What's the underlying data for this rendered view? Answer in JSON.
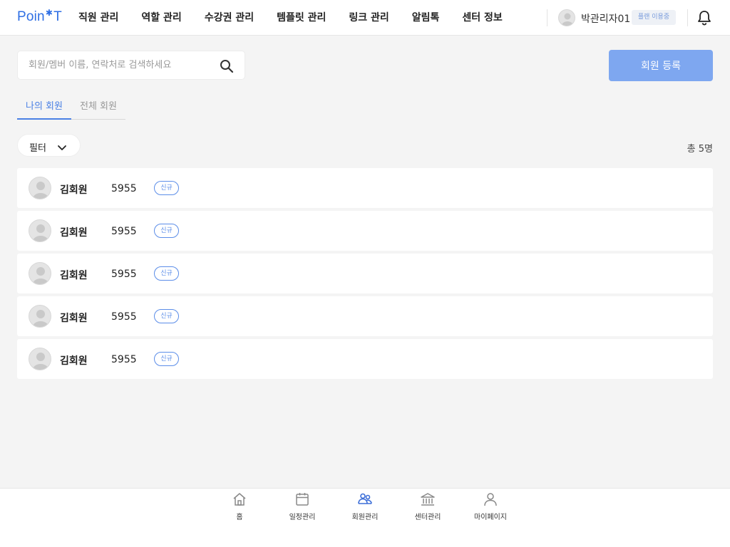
{
  "header": {
    "logo": {
      "left": "Poin",
      "right": "T"
    },
    "nav": [
      {
        "label": "직원 관리"
      },
      {
        "label": "역할 관리"
      },
      {
        "label": "수강권 관리"
      },
      {
        "label": "템플릿 관리"
      },
      {
        "label": "링크 관리"
      },
      {
        "label": "알림톡"
      },
      {
        "label": "센터 정보"
      }
    ],
    "user_name": "박관리자01",
    "plan_badge": "플랜 이용중",
    "icons": {
      "notification": "bell-icon",
      "avatar": "user-avatar-icon"
    }
  },
  "search": {
    "placeholder": "회원/멤버 이름, 연락처로 검색하세요",
    "value": "",
    "icon": "search-icon"
  },
  "register_button": "회원 등록",
  "tabs": [
    {
      "label": "나의 회원",
      "active": true
    },
    {
      "label": "전체 회원",
      "active": false
    }
  ],
  "filter": {
    "label": "필터",
    "icon": "chevron-down-icon"
  },
  "total_count": "총 5명",
  "members": [
    {
      "name": "김회원",
      "number": "5955",
      "badge": "신규"
    },
    {
      "name": "김회원",
      "number": "5955",
      "badge": "신규"
    },
    {
      "name": "김회원",
      "number": "5955",
      "badge": "신규"
    },
    {
      "name": "김회원",
      "number": "5955",
      "badge": "신규"
    },
    {
      "name": "김회원",
      "number": "5955",
      "badge": "신규"
    }
  ],
  "bottom_nav": [
    {
      "label": "홈",
      "icon": "home-icon",
      "active": false
    },
    {
      "label": "일정관리",
      "icon": "calendar-icon",
      "active": false
    },
    {
      "label": "회원관리",
      "icon": "members-icon",
      "active": true
    },
    {
      "label": "센터관리",
      "icon": "building-icon",
      "active": false
    },
    {
      "label": "마이페이지",
      "icon": "person-icon",
      "active": false
    }
  ],
  "colors": {
    "accent": "#4a80e4",
    "register_button": "#7ea7f0",
    "badge": "#5b8de8",
    "background": "#f4f4f4"
  }
}
